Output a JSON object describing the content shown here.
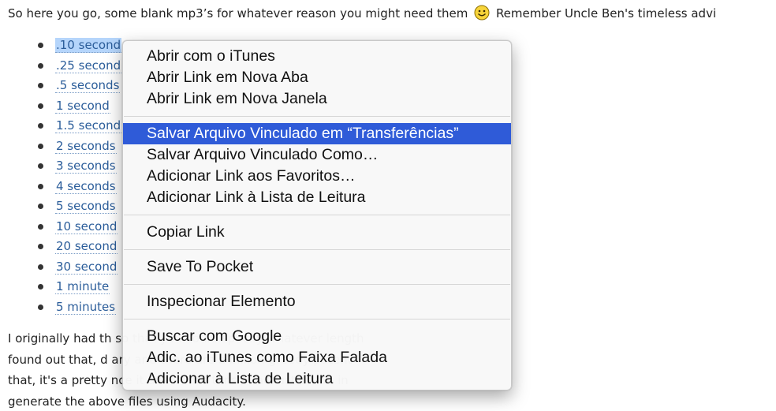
{
  "intro": {
    "before": "So here you go, some blank mp3’s for whatever reason you might need them",
    "after": "Remember Uncle Ben's timeless advi"
  },
  "links": [
    {
      "label": ".10 second"
    },
    {
      "label": ".25 second"
    },
    {
      "label": ".5 seconds"
    },
    {
      "label": "1 second"
    },
    {
      "label": "1.5 second"
    },
    {
      "label": "2 seconds"
    },
    {
      "label": "3 seconds"
    },
    {
      "label": "4 seconds"
    },
    {
      "label": "5 seconds"
    },
    {
      "label": "10 second"
    },
    {
      "label": "20 second"
    },
    {
      "label": "30 second"
    },
    {
      "label": "1 minute"
    },
    {
      "label": "5 minutes"
    }
  ],
  "paragraph": {
    "lines": [
      "I originally had th                                                                                      so that you could specify whatever length",
      "found out that, d                                                                                          ary and there are a billion greedy patent",
      "that, it's a pretty                                                                                           nce it deals with tons of acoustics. So in",
      "generate the above files using Audacity."
    ]
  },
  "context_menu": {
    "groups": [
      [
        "Abrir com o iTunes",
        "Abrir Link em Nova Aba",
        "Abrir Link em Nova Janela"
      ],
      [
        "Salvar Arquivo Vinculado em “Transferências”",
        "Salvar Arquivo Vinculado Como…",
        "Adicionar Link aos Favoritos…",
        "Adicionar Link à Lista de Leitura"
      ],
      [
        "Copiar Link"
      ],
      [
        "Save To Pocket"
      ],
      [
        "Inspecionar Elemento"
      ],
      [
        "Buscar com Google",
        "Adic. ao iTunes como Faixa Falada",
        "Adicionar à Lista de Leitura"
      ]
    ],
    "highlighted": "Salvar Arquivo Vinculado em “Transferências”"
  },
  "colors": {
    "link": "#2b5d9a",
    "selection": "#b5d5fb",
    "menu_highlight": "#2f5bd8"
  },
  "icons": {
    "smiley": "smiley-emoticon-icon"
  }
}
